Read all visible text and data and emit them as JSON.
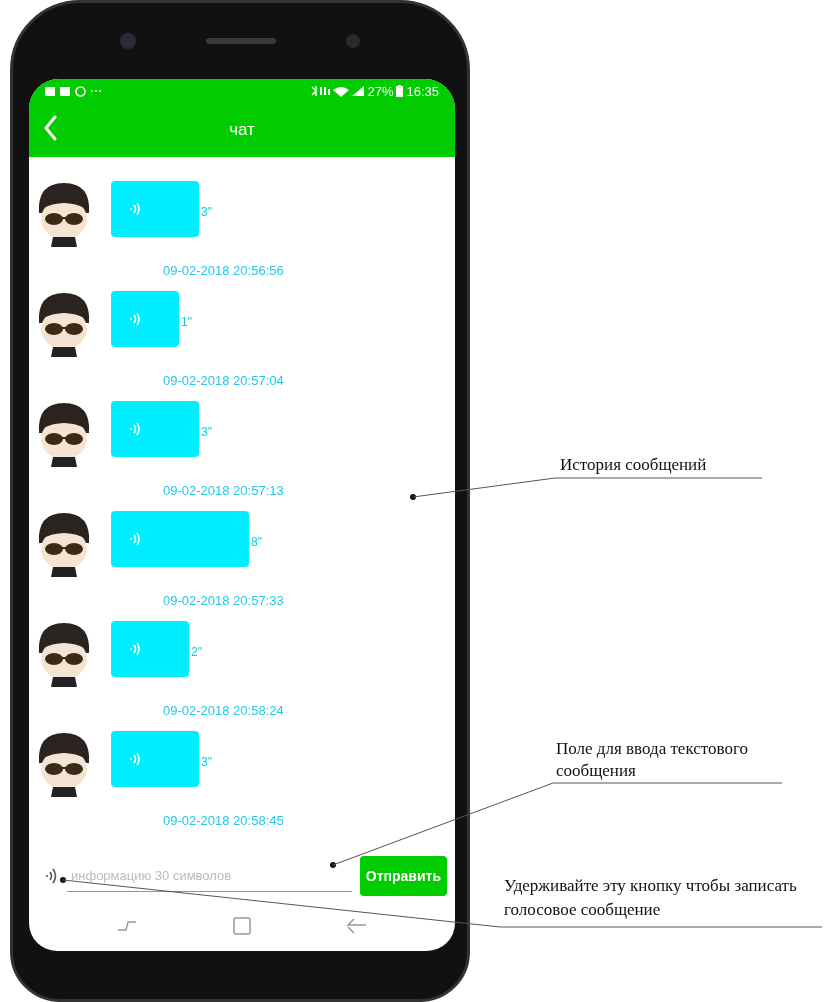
{
  "status_bar": {
    "battery": "27%",
    "time": "16:35"
  },
  "header": {
    "title": "чат"
  },
  "messages": [
    {
      "duration": "3\"",
      "timestamp": "09-02-2018 20:56:56"
    },
    {
      "duration": "1\"",
      "timestamp": "09-02-2018 20:57:04"
    },
    {
      "duration": "3\"",
      "timestamp": "09-02-2018 20:57:13"
    },
    {
      "duration": "8\"",
      "timestamp": "09-02-2018 20:57:33"
    },
    {
      "duration": "2\"",
      "timestamp": "09-02-2018 20:58:24"
    },
    {
      "duration": "3\"",
      "timestamp": "09-02-2018 20:58:45"
    }
  ],
  "input": {
    "placeholder": "информацию 30 символов",
    "send_button": "Отправить"
  },
  "annotations": [
    {
      "text": "История сообщений"
    },
    {
      "text": "Поле для ввода текстового сообщения"
    },
    {
      "text": "Удерживайте эту кнопку чтобы записать голосовое сообщение"
    }
  ]
}
